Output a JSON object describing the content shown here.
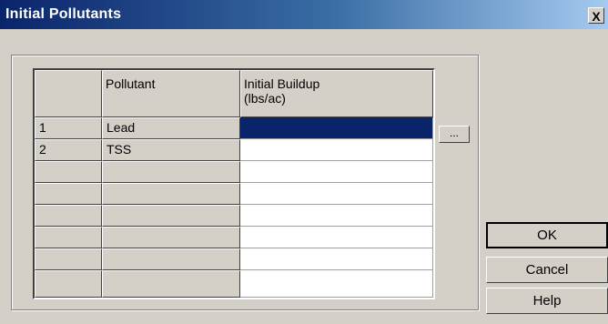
{
  "window": {
    "title": "Initial Pollutants",
    "close_glyph": "X"
  },
  "grid": {
    "headers": [
      "",
      "Pollutant",
      "Initial Buildup\n(lbs/ac)"
    ],
    "rows": [
      {
        "num": "1",
        "pollutant": "Lead",
        "value": ""
      },
      {
        "num": "2",
        "pollutant": "TSS",
        "value": ""
      },
      {
        "num": "",
        "pollutant": "",
        "value": ""
      },
      {
        "num": "",
        "pollutant": "",
        "value": ""
      },
      {
        "num": "",
        "pollutant": "",
        "value": ""
      },
      {
        "num": "",
        "pollutant": "",
        "value": ""
      },
      {
        "num": "",
        "pollutant": "",
        "value": ""
      }
    ],
    "ellipsis_label": "...",
    "selected_color": "#0a246a"
  },
  "buttons": {
    "ok": "OK",
    "cancel": "Cancel",
    "help": "Help"
  }
}
